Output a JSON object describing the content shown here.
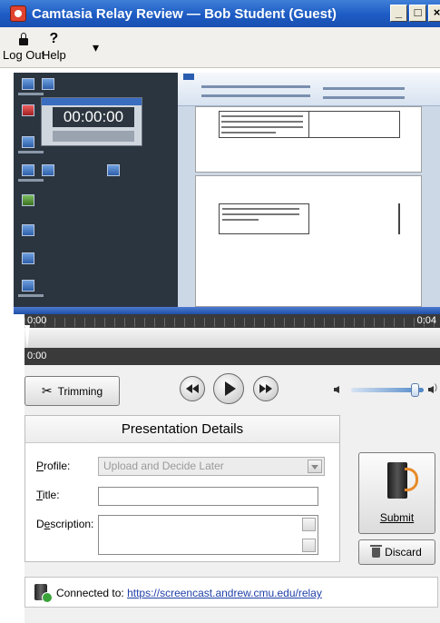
{
  "window": {
    "title": "Camtasia Relay Review — Bob Student (Guest)",
    "controls": [
      "_",
      "□",
      "×"
    ]
  },
  "menu": {
    "logout": "Log Out",
    "help": "Help",
    "help_glyph": "?"
  },
  "preview": {
    "recorder_time": "00:00:00"
  },
  "timeline": {
    "start_time": "0:00",
    "end_time": "0:04",
    "current_time": "0:00"
  },
  "controls": {
    "trimming_label": "Trimming",
    "volume_level": 0.88
  },
  "details": {
    "header": "Presentation Details",
    "profile_label": "Profile:",
    "profile_value": "Upload and Decide Later",
    "title_label": "Title:",
    "title_value": "",
    "description_label": "Description:",
    "description_value": ""
  },
  "actions": {
    "submit_label": "Submit",
    "discard_label": "Discard"
  },
  "status": {
    "prefix": "Connected to:",
    "url": "https://screencast.andrew.cmu.edu/relay"
  },
  "colors": {
    "titlebar": "#1d5bc4",
    "preview_bg": "#2b3540",
    "timeline_bg": "#3a3a3a",
    "accent_orange": "#e88a2a",
    "link": "#1f3fa8"
  }
}
